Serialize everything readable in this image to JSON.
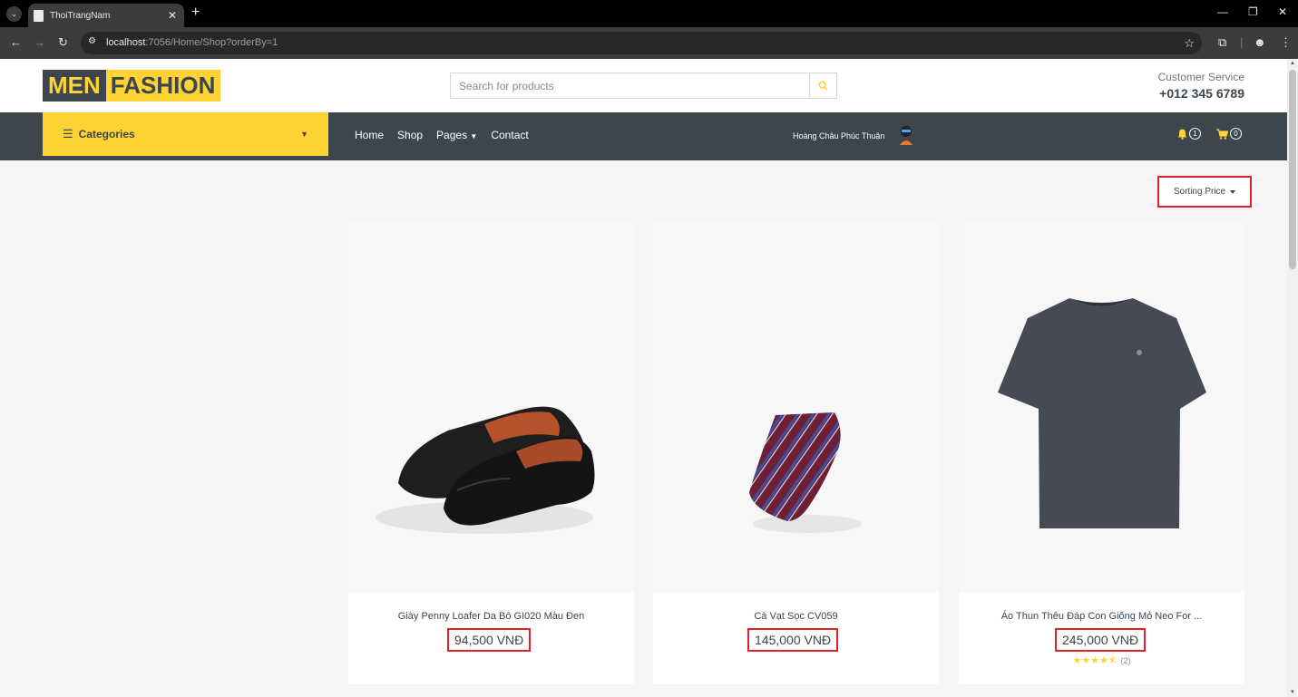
{
  "browser": {
    "tab_title": "ThoiTrangNam",
    "url_host": "localhost",
    "url_path": ":7056/Home/Shop?orderBy=1"
  },
  "header": {
    "logo_part1": "MEN",
    "logo_part2": "FASHION",
    "search_placeholder": "Search for products",
    "customer_service_label": "Customer Service",
    "phone": "+012 345 6789"
  },
  "nav": {
    "categories_label": "Categories",
    "links": [
      "Home",
      "Shop",
      "Pages",
      "Contact"
    ],
    "user_name": "Hoàng Châu Phúc Thuận",
    "notification_count": "1",
    "cart_count": "0"
  },
  "sort": {
    "label": "Sorting Price"
  },
  "products": [
    {
      "name": "Giày Penny Loafer Da Bò GI020 Màu Đen",
      "price": "94,500 VNĐ"
    },
    {
      "name": "Cà Vạt Sọc CV059",
      "price": "145,000 VNĐ"
    },
    {
      "name": "Áo Thun Thêu Đáp Con Giống Mỏ Neo For ...",
      "price": "245,000 VNĐ",
      "rating": 4.5,
      "review_count": "(2)"
    }
  ],
  "colors": {
    "brand_yellow": "#ffd333",
    "brand_dark": "#3d464d",
    "highlight_red": "#e0202a"
  }
}
